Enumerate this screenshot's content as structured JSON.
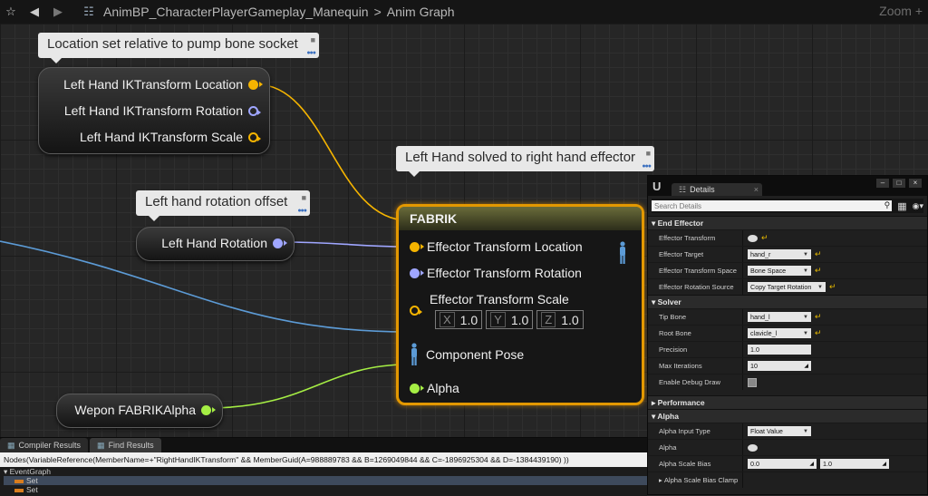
{
  "topbar": {
    "breadcrumb_asset": "AnimBP_CharacterPlayerGameplay_Manequin",
    "breadcrumb_separator": ">",
    "breadcrumb_graph": "Anim Graph",
    "zoom": "Zoom +"
  },
  "comments": {
    "location": "Location set relative to pump bone socket",
    "fabrik": "Left Hand solved to right hand effector",
    "rotation": "Left hand rotation offset"
  },
  "nodes": {
    "ik_location": "Left Hand IKTransform Location",
    "ik_rotation": "Left Hand IKTransform Rotation",
    "ik_scale": "Left Hand IKTransform Scale",
    "left_hand_rotation": "Left Hand Rotation",
    "fabrik_alpha": "Wepon FABRIKAlpha"
  },
  "fabrik": {
    "title": "FABRIK",
    "pin_location": "Effector Transform Location",
    "pin_rotation": "Effector Transform Rotation",
    "pin_scale": "Effector Transform Scale",
    "scale_x_label": "X",
    "scale_x": "1.0",
    "scale_y_label": "Y",
    "scale_y": "1.0",
    "scale_z_label": "Z",
    "scale_z": "1.0",
    "pin_pose": "Component Pose",
    "pin_alpha": "Alpha"
  },
  "results": {
    "tab_compiler": "Compiler Results",
    "tab_find": "Find Results",
    "query": "Nodes(VariableReference(MemberName=+\"RightHandIKTransform\" && MemberGuid(A=988889783 && B=1269049844 && C=-1896925304 && D=-1384439190) ))",
    "tree_root": "EventGraph",
    "tree_items": [
      "Set",
      "Set"
    ]
  },
  "details": {
    "tab": "Details",
    "search_placeholder": "Search Details",
    "sections": {
      "end_effector": "End Effector",
      "solver": "Solver",
      "performance": "Performance",
      "alpha": "Alpha"
    },
    "rows": {
      "effector_transform": "Effector Transform",
      "effector_target": "Effector Target",
      "effector_target_value": "hand_r",
      "effector_transform_space": "Effector Transform Space",
      "effector_transform_space_value": "Bone Space",
      "effector_rotation_source": "Effector Rotation Source",
      "effector_rotation_source_value": "Copy Target Rotation",
      "tip_bone": "Tip Bone",
      "tip_bone_value": "hand_l",
      "root_bone": "Root Bone",
      "root_bone_value": "clavicle_l",
      "precision": "Precision",
      "precision_value": "1.0",
      "max_iterations": "Max Iterations",
      "max_iterations_value": "10",
      "enable_debug_draw": "Enable Debug Draw",
      "alpha_input_type": "Alpha Input Type",
      "alpha_input_type_value": "Float Value",
      "alpha": "Alpha",
      "alpha_scale_bias": "Alpha Scale Bias",
      "alpha_scale_bias_min": "0.0",
      "alpha_scale_bias_max": "1.0",
      "alpha_scale_bias_clamp": "Alpha Scale Bias Clamp"
    }
  },
  "colors": {
    "vector_pin": "#f5b400",
    "rotator_pin": "#9fa6ff",
    "float_pin": "#a5ee44",
    "pose_pin": "#5c9bd6",
    "selection": "#e39800"
  }
}
